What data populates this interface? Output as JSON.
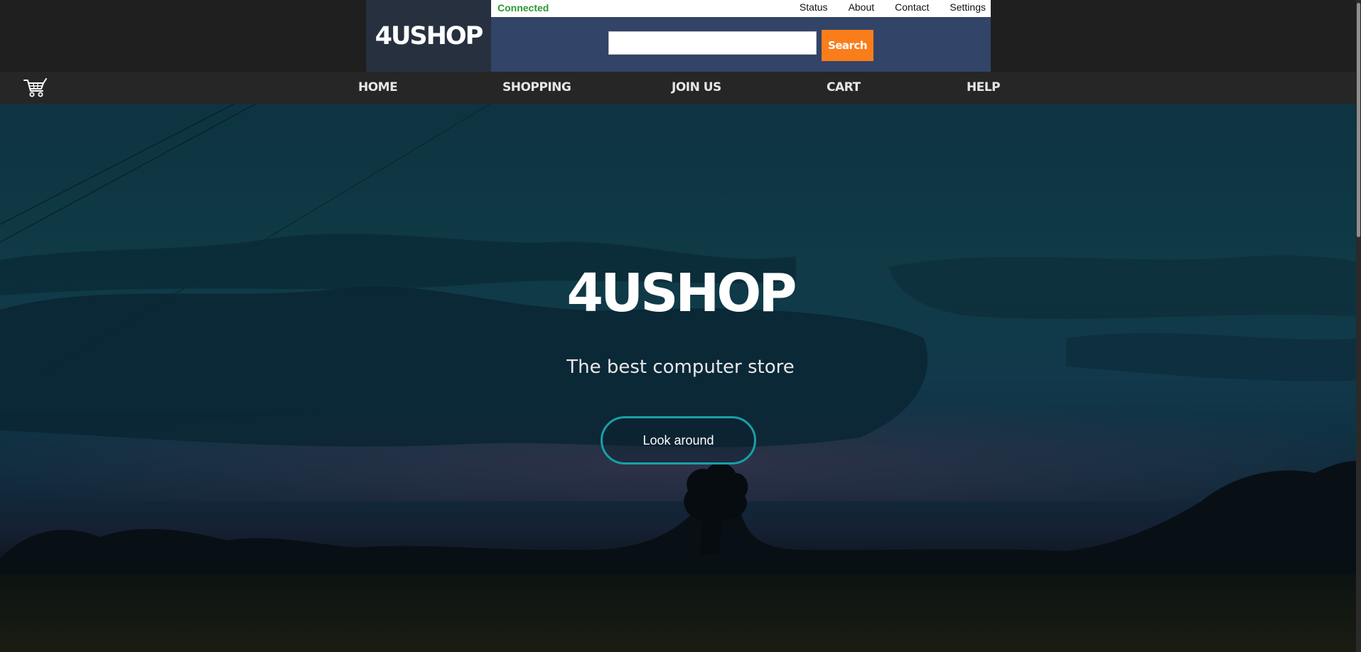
{
  "header": {
    "brand": "4USHOP",
    "status": "Connected",
    "util_links": [
      {
        "label": "Status"
      },
      {
        "label": "About"
      },
      {
        "label": "Contact"
      },
      {
        "label": "Settings"
      }
    ],
    "search": {
      "placeholder": "",
      "value": "",
      "button_label": "Search"
    }
  },
  "nav": {
    "cart_icon": "shopping-cart-icon",
    "items": [
      {
        "label": "HOME"
      },
      {
        "label": "SHOPPING"
      },
      {
        "label": "JOIN US"
      },
      {
        "label": "CART"
      },
      {
        "label": "HELP"
      }
    ]
  },
  "hero": {
    "title": "4USHOP",
    "subtitle": "The best computer store",
    "button_label": "Look around"
  },
  "colors": {
    "header_bg": "#1e1f1e",
    "brand_box": "#27303f",
    "search_area": "#324467",
    "search_button": "#fa7d1b",
    "status_green": "#2a9a2f",
    "nav_bg": "#262626",
    "hero_button_border": "#17a1a6"
  }
}
